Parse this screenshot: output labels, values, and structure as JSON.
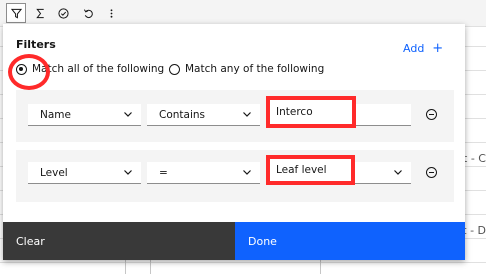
{
  "toolbar": {
    "icons": [
      "filter-icon",
      "sum-icon",
      "check-circle-icon",
      "undo-icon",
      "overflow-menu-icon"
    ]
  },
  "background": {
    "row_text_1": "nt - C",
    "row_text_2": "nt - D"
  },
  "filters": {
    "title": "Filters",
    "add_label": "Add",
    "match_all_label": "Match all of the following",
    "match_any_label": "Match any of the following",
    "match_mode": "all",
    "conditions": [
      {
        "field": "Name",
        "operator": "Contains",
        "value": "Interco"
      },
      {
        "field": "Level",
        "operator": "=",
        "value": "Leaf level"
      }
    ]
  },
  "footer": {
    "clear_label": "Clear",
    "done_label": "Done"
  },
  "colors": {
    "primary": "#0f62fe",
    "secondary": "#393939",
    "highlight": "#ff2a2a"
  }
}
